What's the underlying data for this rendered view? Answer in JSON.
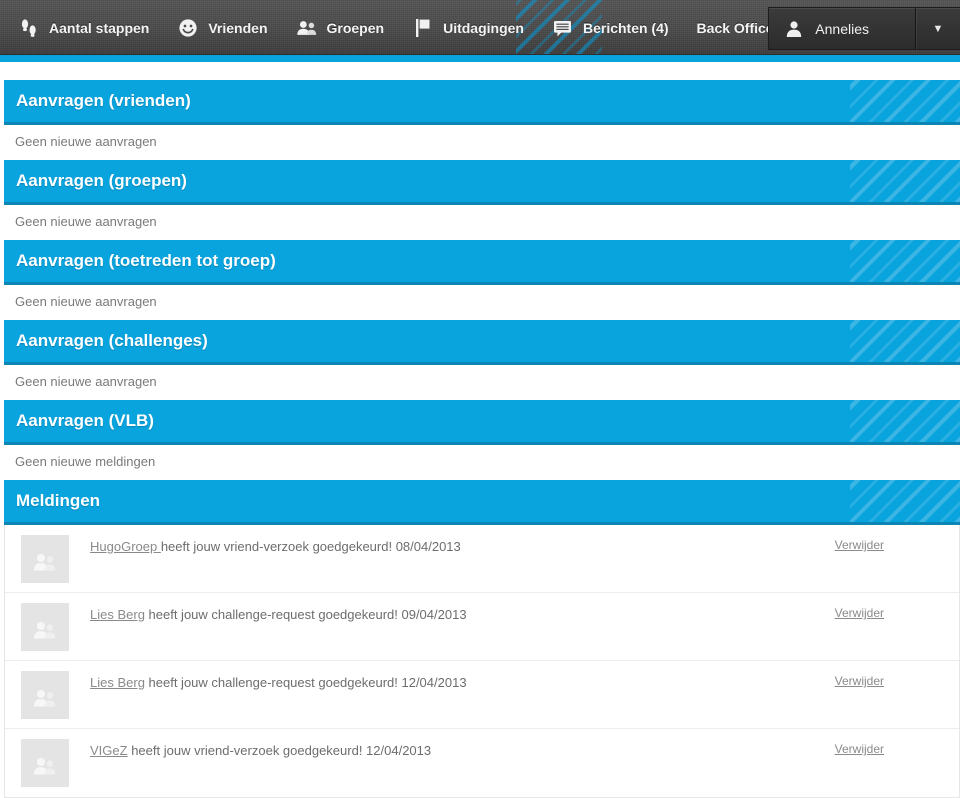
{
  "navbar": {
    "items": [
      {
        "label": "Aantal stappen",
        "icon": "footsteps-icon"
      },
      {
        "label": "Vrienden",
        "icon": "smiley-icon"
      },
      {
        "label": "Groepen",
        "icon": "people-icon"
      },
      {
        "label": "Uitdagingen",
        "icon": "flag-icon"
      },
      {
        "label": "Berichten (4)",
        "icon": "message-icon"
      },
      {
        "label": "Back Office",
        "icon": "none"
      }
    ],
    "account": {
      "name": "Annelies",
      "avatar_icon": "user-icon",
      "caret_icon": "chevron-down-icon",
      "caret_glyph": "▼"
    }
  },
  "colors": {
    "accent": "#09a3dd",
    "accent_border": "#0b86b5",
    "navbar": "#4a4a4a",
    "text": "#6d6d6d",
    "link": "#8a8a8a"
  },
  "panels": [
    {
      "title": "Aanvragen (vrienden)",
      "empty_text": "Geen nieuwe aanvragen"
    },
    {
      "title": "Aanvragen (groepen)",
      "empty_text": "Geen nieuwe aanvragen"
    },
    {
      "title": "Aanvragen (toetreden tot groep)",
      "empty_text": "Geen nieuwe aanvragen"
    },
    {
      "title": "Aanvragen (challenges)",
      "empty_text": "Geen nieuwe aanvragen"
    },
    {
      "title": "Aanvragen (VLB)",
      "empty_text": "Geen nieuwe meldingen"
    }
  ],
  "notifications": {
    "title": "Meldingen",
    "delete_label": "Verwijder",
    "avatar_icon": "people-placeholder-icon",
    "rows": [
      {
        "actor": "HugoGroep ",
        "message": "heeft jouw vriend-verzoek goedgekeurd! 08/04/2013"
      },
      {
        "actor": "Lies Berg",
        "message": " heeft jouw challenge-request goedgekeurd! 09/04/2013"
      },
      {
        "actor": "Lies Berg",
        "message": " heeft jouw challenge-request goedgekeurd! 12/04/2013"
      },
      {
        "actor": "VIGeZ",
        "message": " heeft jouw vriend-verzoek goedgekeurd! 12/04/2013"
      }
    ]
  }
}
